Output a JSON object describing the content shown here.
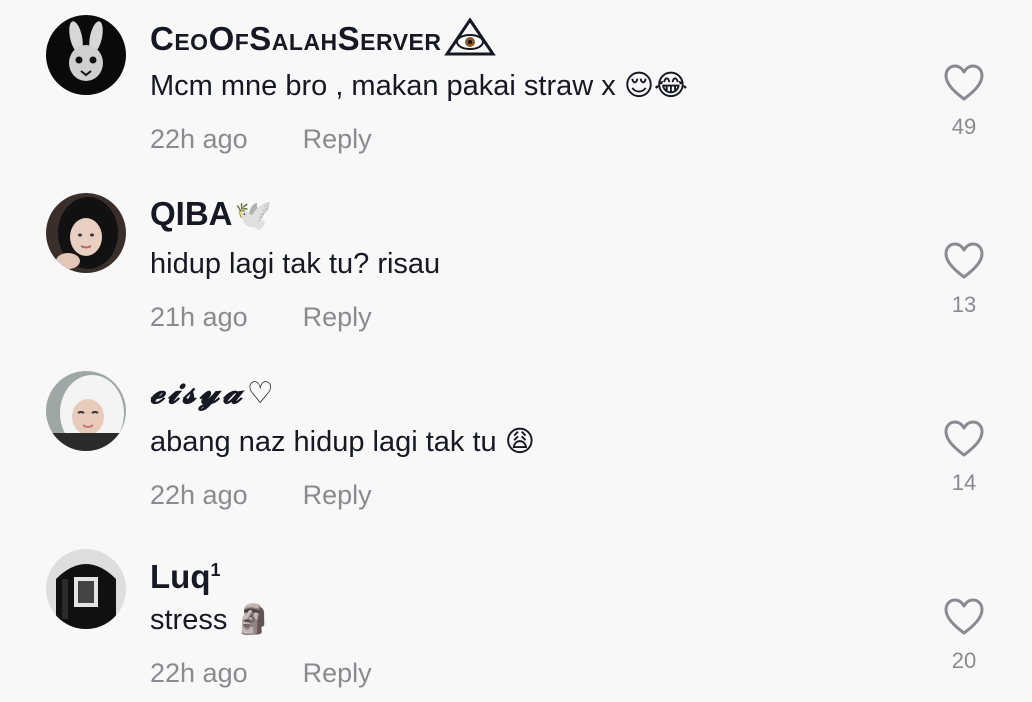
{
  "comments": [
    {
      "username": "CeoOfSalahServer",
      "username_badge": "👁",
      "text": "Mcm mne bro , makan pakai straw x",
      "emoji": "😌😂",
      "time": "22h ago",
      "reply_label": "Reply",
      "likes": "49",
      "avatar_icon": "bunny-mask-avatar"
    },
    {
      "username": "QIBA",
      "username_badge": "🕊️",
      "text": "hidup lagi tak tu? risau",
      "emoji": "",
      "time": "21h ago",
      "reply_label": "Reply",
      "likes": "13",
      "avatar_icon": "hijab-girl-avatar"
    },
    {
      "username": "𝓮𝓲𝓼𝔂𝓪",
      "username_badge": "♡",
      "text": "abang naz hidup lagi tak tu",
      "emoji": "😩",
      "time": "22h ago",
      "reply_label": "Reply",
      "likes": "14",
      "avatar_icon": "white-hijab-girl-avatar"
    },
    {
      "username": "Luq",
      "username_badge": "1",
      "text": "stress",
      "emoji": "🗿",
      "time": "22h ago",
      "reply_label": "Reply",
      "likes": "20",
      "avatar_icon": "hoodie-avatar"
    }
  ],
  "colors": {
    "background": "#f8f8f8",
    "primary_text": "#161823",
    "secondary_text": "#8a8b91"
  }
}
